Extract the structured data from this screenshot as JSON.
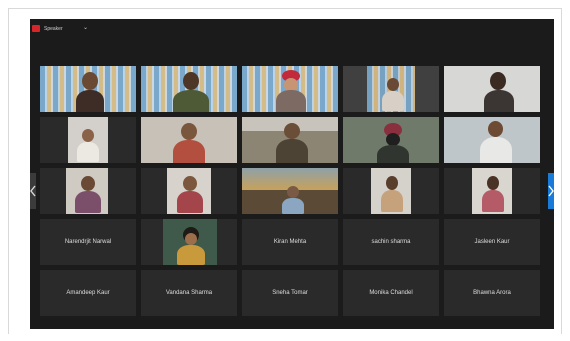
{
  "window": {
    "menu_label": "Speaker",
    "caret": "⌄",
    "accent_recording": "#d6262a"
  },
  "nav": {
    "prev_icon": "chevron-left-icon",
    "next_icon": "chevron-right-icon"
  },
  "named_tiles_row4": [
    "Narendrjit Narwal",
    "Kiran Mehta",
    "sachin sharma",
    "Jasleen Kaur"
  ],
  "named_tiles_row5": [
    "Amandeep Kaur",
    "Vandana Sharma",
    "Sneha Tomar",
    "Monika Chandel",
    "Bhawna Arora"
  ],
  "colors": {
    "background": "#1b1b1b",
    "tile": "#2a2a2a",
    "label": "#dedede",
    "accent_blue": "#1a7ad8"
  }
}
